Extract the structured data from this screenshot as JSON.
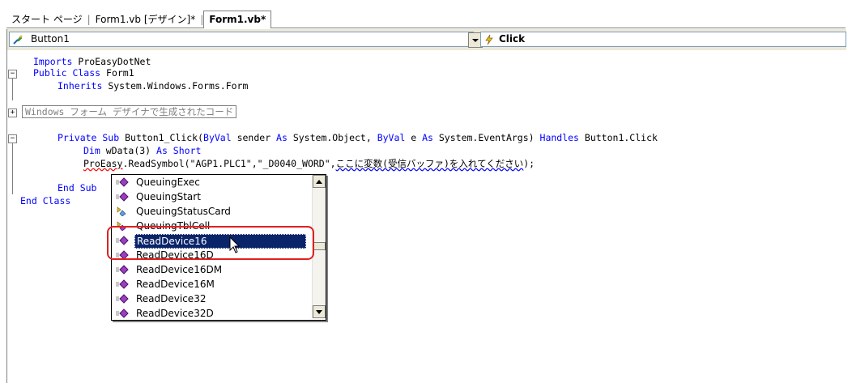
{
  "tabs": [
    {
      "label": "スタート ページ",
      "active": false
    },
    {
      "label": "Form1.vb [デザイン]*",
      "active": false
    },
    {
      "label": "Form1.vb*",
      "active": true
    }
  ],
  "combobar": {
    "object_name": "Button1",
    "event_name": "Click"
  },
  "code": {
    "line1_kw": "Imports",
    "line1_rest": " ProEasyDotNet",
    "line2_kw": "Public Class",
    "line2_rest": " Form1",
    "line3_kw": "Inherits",
    "line3_rest": " System.Windows.Forms.Form",
    "region_label": "Windows フォーム デザイナで生成されたコード",
    "sub_kw1": "Private Sub",
    "sub_name": " Button1_Click(",
    "sub_kw2": "ByVal",
    "sub_mid1": " sender ",
    "sub_kw3": "As",
    "sub_mid2": " System.Object, ",
    "sub_kw4": "ByVal",
    "sub_mid3": " e ",
    "sub_kw5": "As",
    "sub_mid4": " System.EventArgs) ",
    "sub_kw6": "Handles",
    "sub_end": " Button1.Click",
    "dim_kw": "Dim",
    "dim_mid": " wData(3) ",
    "dim_kw2": "As Short",
    "call_obj": "ProEasy",
    "call_rest": ".ReadSymbol(\"AGP1.PLC1\",\"_D0040_WORD\",",
    "call_hint": "ここに変数(受信バッファ)を入れてください",
    "call_end": ");",
    "endsub": "End Sub",
    "endclass": "End Class"
  },
  "intellisense": {
    "items": [
      {
        "label": "QueuingExec",
        "icon": "method-icon"
      },
      {
        "label": "QueuingStart",
        "icon": "method-icon"
      },
      {
        "label": "QueuingStatusCard",
        "icon": "property-icon"
      },
      {
        "label": "QueuingTblCell",
        "icon": "property-icon"
      },
      {
        "label": "ReadDevice16",
        "icon": "method-icon",
        "selected": true
      },
      {
        "label": "ReadDevice16D",
        "icon": "method-icon"
      },
      {
        "label": "ReadDevice16DM",
        "icon": "method-icon"
      },
      {
        "label": "ReadDevice16M",
        "icon": "method-icon"
      },
      {
        "label": "ReadDevice32",
        "icon": "method-icon"
      },
      {
        "label": "ReadDevice32D",
        "icon": "method-icon"
      }
    ]
  },
  "colors": {
    "keyword": "#0000ff",
    "selection": "#0a246a",
    "highlight_box": "#e02020"
  }
}
